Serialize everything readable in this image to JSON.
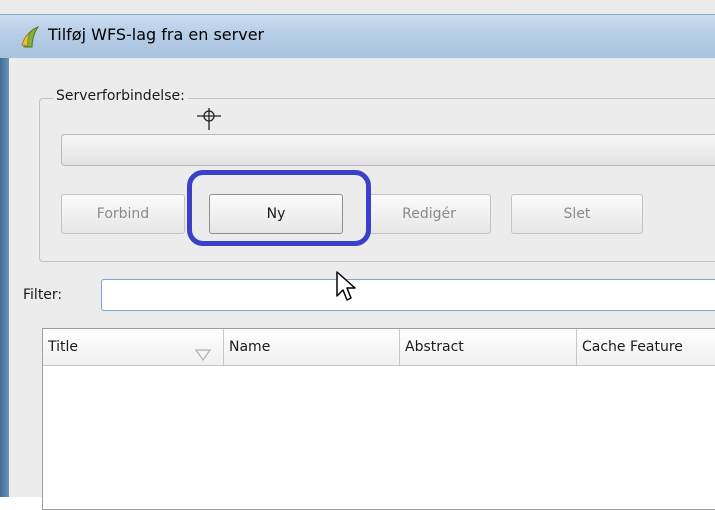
{
  "window": {
    "title": "Tilføj WFS-lag fra en server"
  },
  "server_group": {
    "title": "Serverforbindelse:",
    "connection_combo": {
      "value": ""
    },
    "buttons": {
      "connect": "Forbind",
      "new": "Ny",
      "edit": "Redigér",
      "delete": "Slet"
    }
  },
  "filter": {
    "label": "Filter:",
    "value": ""
  },
  "table": {
    "columns": [
      "Title",
      "Name",
      "Abstract",
      "Cache Feature"
    ],
    "rows": []
  },
  "colors": {
    "highlight": "#3c3fc9",
    "titlebar": "#b6cde6",
    "focus_border": "#7aa7d6"
  },
  "icons": {
    "app": "qgis-icon",
    "crosshair": "crosshair-icon",
    "cursor": "mouse-pointer-icon",
    "sort": "sort-indicator-icon"
  }
}
